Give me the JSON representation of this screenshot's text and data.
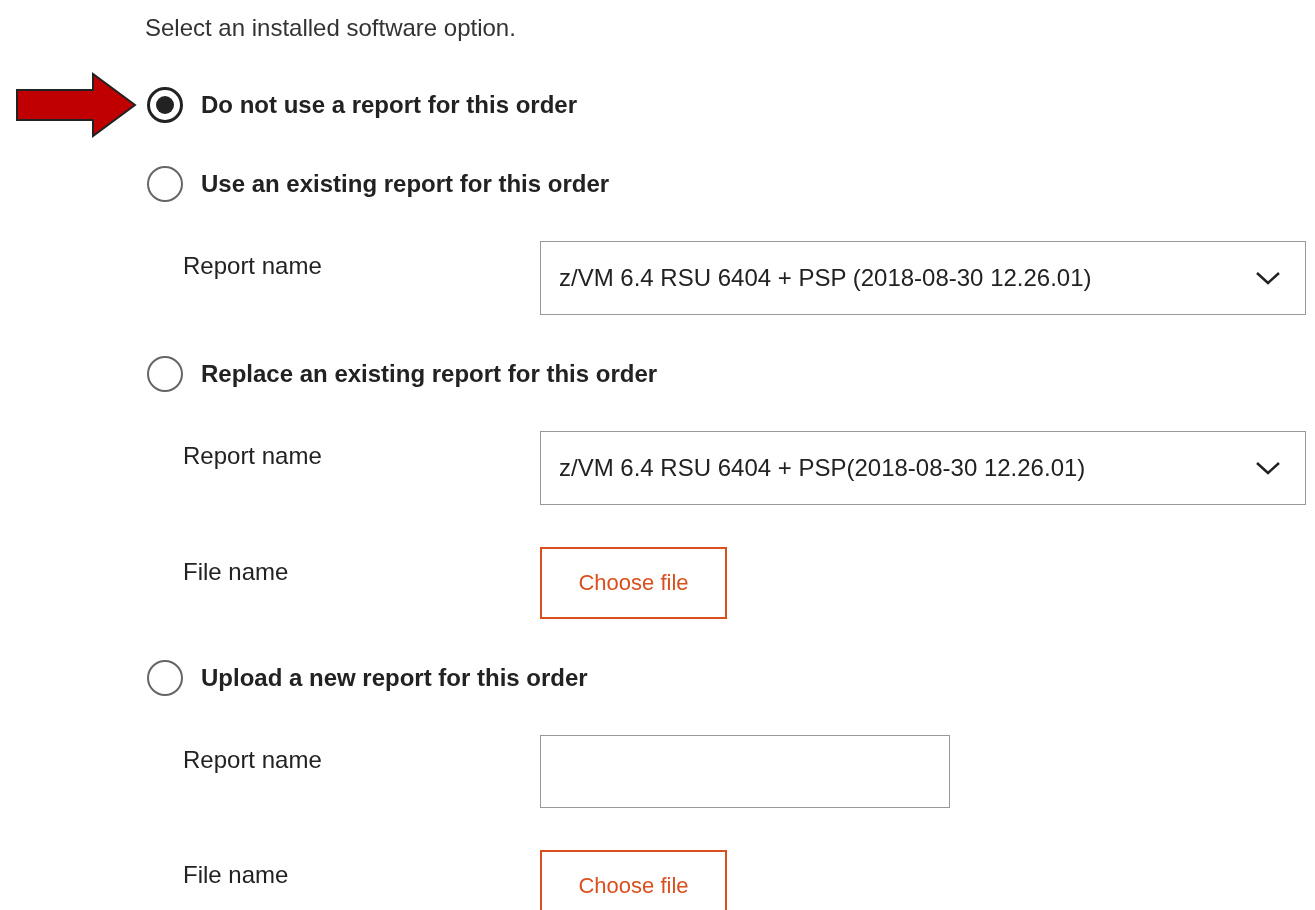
{
  "instruction": "Select an installed software option.",
  "options": [
    {
      "label": "Do not use a report for this order",
      "selected": true,
      "pointed": true
    },
    {
      "label": "Use an existing report for this order",
      "selected": false,
      "pointed": false,
      "fields": [
        {
          "kind": "select",
          "label": "Report name",
          "value": "z/VM 6.4 RSU 6404 + PSP (2018-08-30 12.26.01)"
        }
      ]
    },
    {
      "label": "Replace an existing report for this order",
      "selected": false,
      "pointed": false,
      "fields": [
        {
          "kind": "select",
          "label": "Report name",
          "value": "z/VM 6.4 RSU 6404 + PSP(2018-08-30 12.26.01)"
        },
        {
          "kind": "file",
          "label": "File name",
          "button": "Choose file"
        }
      ]
    },
    {
      "label": "Upload a new report for this order",
      "selected": false,
      "pointed": false,
      "fields": [
        {
          "kind": "text",
          "label": "Report name"
        },
        {
          "kind": "file",
          "label": "File name",
          "button": "Choose file"
        }
      ]
    }
  ]
}
